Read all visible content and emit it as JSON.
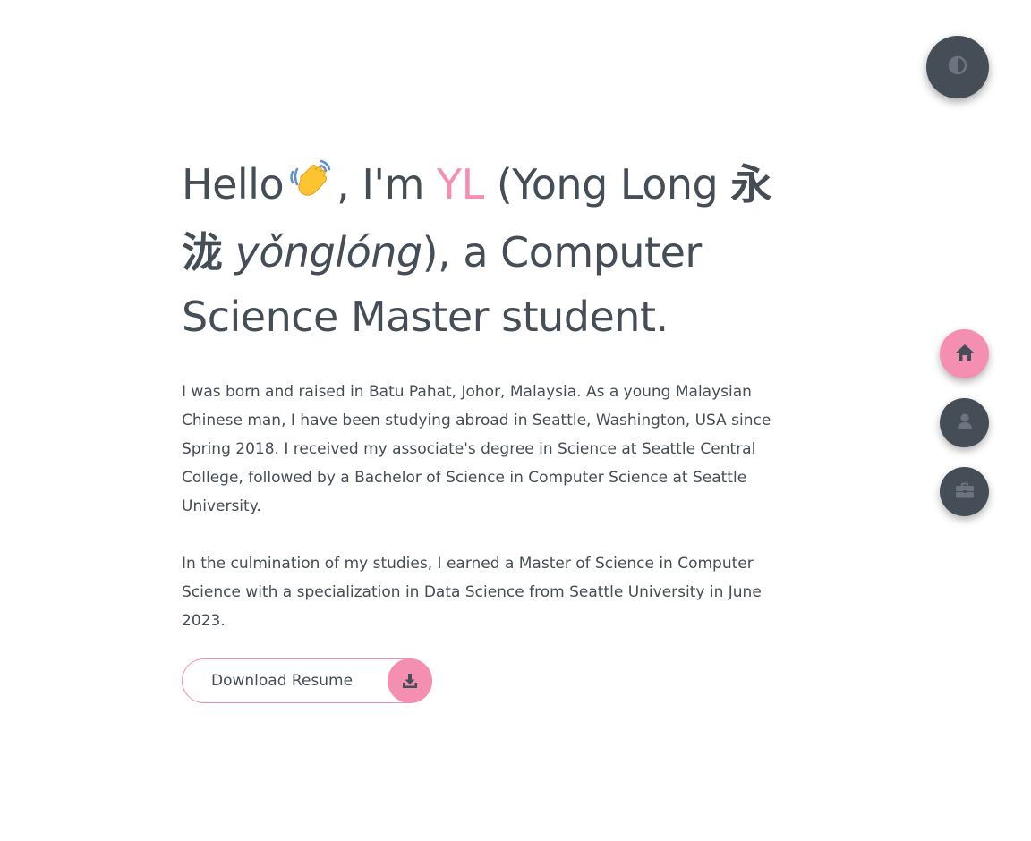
{
  "theme_toggle": {
    "icon": "contrast-icon"
  },
  "intro": {
    "hello": "Hello",
    "after_wave": ", I'm ",
    "nickname": "YL",
    "name_open": " (Yong Long ",
    "chinese_name": "永泷",
    "pinyin": "yǒnglóng",
    "rest": "), a Computer Science Master student."
  },
  "bio": {
    "paragraph1": "I was born and raised in Batu Pahat, Johor, Malaysia. As a young Malaysian Chinese man, I have been studying abroad in Seattle, Washington, USA since Spring 2018. I received my associate's degree in Science at Seattle Central College, followed by a Bachelor of Science in Computer Science at Seattle University.",
    "paragraph2": "In the culmination of my studies, I earned a Master of Science in Computer Science with a specialization in Data Science from Seattle University in June 2023."
  },
  "resume_button": {
    "label": "Download Resume",
    "icon": "download-icon"
  },
  "side_nav": {
    "items": [
      {
        "icon": "home-icon",
        "active": true
      },
      {
        "icon": "user-icon",
        "active": false
      },
      {
        "icon": "briefcase-icon",
        "active": false
      }
    ]
  },
  "colors": {
    "text": "#454d57",
    "accent": "#f48fb1",
    "background": "#ffffff"
  }
}
